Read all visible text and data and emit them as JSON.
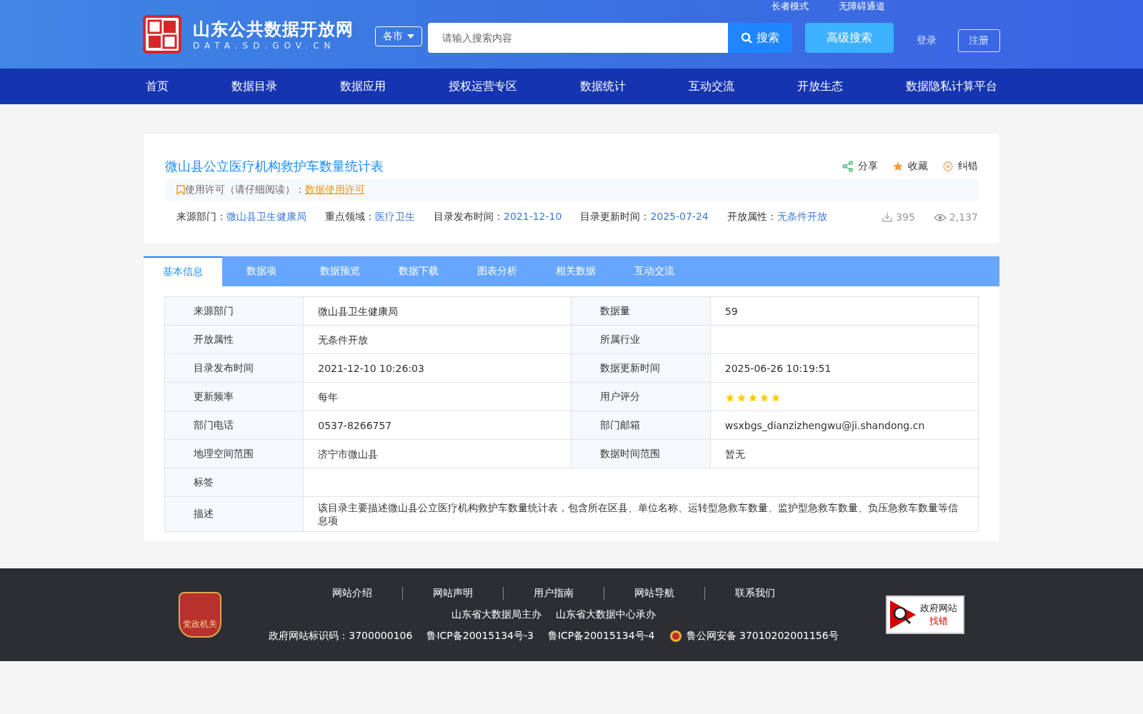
{
  "header": {
    "site_name": "山东公共数据开放网",
    "site_domain": "DATA.SD.GOV.CN",
    "top_links": [
      "长者模式",
      "无障碍通道"
    ],
    "city_select": "各市",
    "search": {
      "placeholder": "请输入搜索内容",
      "button": "搜索"
    },
    "advanced_search": "高级搜索",
    "login": "登录",
    "register": "注册"
  },
  "nav": [
    {
      "label": "首页",
      "selected": false
    },
    {
      "label": "数据目录",
      "selected": false
    },
    {
      "label": "数据应用",
      "selected": false
    },
    {
      "label": "授权运营专区",
      "selected": false
    },
    {
      "label": "数据统计",
      "selected": false
    },
    {
      "label": "互动交流",
      "selected": false
    },
    {
      "label": "开放生态",
      "selected": false
    },
    {
      "label": "数据隐私计算平台",
      "selected": false
    }
  ],
  "dataset": {
    "title": "微山县公立医疗机构救护车数量统计表",
    "actions": [
      {
        "kind": "share",
        "label": "分享"
      },
      {
        "kind": "favorite",
        "label": "收藏"
      },
      {
        "kind": "report",
        "label": "纠错"
      }
    ],
    "license_label": "使用许可（请仔细阅读）：",
    "license_link": "数据使用许可",
    "meta": [
      {
        "label": "来源部门：",
        "value": "微山县卫生健康局"
      },
      {
        "label": "重点领域：",
        "value": "医疗卫生"
      },
      {
        "label": "目录发布时间：",
        "value": "2021-12-10"
      },
      {
        "label": "目录更新时间：",
        "value": "2025-07-24"
      },
      {
        "label": "开放属性：",
        "value": "无条件开放"
      }
    ],
    "downloads": "395",
    "views": "2,137"
  },
  "tabs": [
    {
      "label": "基本信息",
      "selected": true
    },
    {
      "label": "数据项",
      "selected": false
    },
    {
      "label": "数据预览",
      "selected": false
    },
    {
      "label": "数据下载",
      "selected": false
    },
    {
      "label": "图表分析",
      "selected": false
    },
    {
      "label": "相关数据",
      "selected": false
    },
    {
      "label": "互动交流",
      "selected": false
    }
  ],
  "info_table": [
    {
      "cells": [
        {
          "label": "来源部门",
          "value": "微山县卫生健康局"
        },
        {
          "label": "数据量",
          "value": "59"
        }
      ]
    },
    {
      "cells": [
        {
          "label": "开放属性",
          "value": "无条件开放"
        },
        {
          "label": "所属行业"
        }
      ]
    },
    {
      "cells": [
        {
          "label": "目录发布时间",
          "value": "2021-12-10 10:26:03"
        },
        {
          "label": "数据更新时间",
          "value": "2025-06-26 10:19:51"
        }
      ]
    },
    {
      "cells": [
        {
          "label": "更新频率",
          "value": "每年"
        },
        {
          "label": "用户评分",
          "stars": 5
        }
      ]
    },
    {
      "cells": [
        {
          "label": "部门电话",
          "value": "0537-8266757"
        },
        {
          "label": "部门邮箱",
          "value": "wsxbgs_dianzizhengwu@ji.shandong.cn"
        }
      ]
    },
    {
      "cells": [
        {
          "label": "地理空间范围",
          "value": "济宁市微山县"
        },
        {
          "label": "数据时间范围",
          "value": "暂无"
        }
      ]
    },
    {
      "cells": [
        {
          "label": "标签"
        }
      ]
    },
    {
      "cells": [
        {
          "label": "描述",
          "value": "该目录主要描述微山县公立医疗机构救护车数量统计表，包含所在区县、单位名称、运转型急救车数量、监护型急救车数量、负压急救车数量等信息项"
        }
      ]
    }
  ],
  "footer": {
    "links": [
      "网站介绍",
      "网站声明",
      "用户指南",
      "网站导航",
      "联系我们"
    ],
    "sponsors": [
      "山东省大数据局主办",
      "山东省大数据中心承办"
    ],
    "records": [
      "政府网站标识码：3700000106",
      "鲁ICP备20015134号-3",
      "鲁ICP备20015134号-4",
      "鲁公网安备 37010202001156号"
    ],
    "badge": "党政机关",
    "report_badge": [
      "政府网站",
      "找错"
    ]
  }
}
